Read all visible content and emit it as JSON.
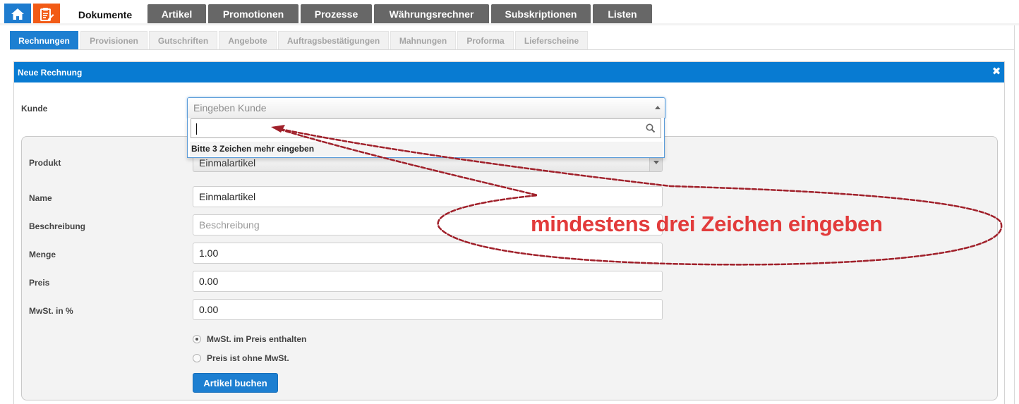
{
  "icons": {
    "home": "home-icon",
    "documents": "document-edit-icon",
    "close": "close-icon",
    "search": "search-icon"
  },
  "colors": {
    "accent": "#1d7fd1",
    "home_button": "#1e7ccf",
    "doc_button": "#f25b16",
    "tab_inactive": "#676767",
    "annotation": "#e23b3b",
    "annotation_line": "#a0202a"
  },
  "main_tabs": [
    {
      "label": "Dokumente",
      "active": true
    },
    {
      "label": "Artikel"
    },
    {
      "label": "Promotionen"
    },
    {
      "label": "Prozesse"
    },
    {
      "label": "Währungsrechner"
    },
    {
      "label": "Subskriptionen"
    },
    {
      "label": "Listen"
    }
  ],
  "sub_tabs": [
    {
      "label": "Rechnungen",
      "active": true
    },
    {
      "label": "Provisionen"
    },
    {
      "label": "Gutschriften"
    },
    {
      "label": "Angebote"
    },
    {
      "label": "Auftragsbestätigungen"
    },
    {
      "label": "Mahnungen"
    },
    {
      "label": "Proforma"
    },
    {
      "label": "Lieferscheine"
    }
  ],
  "panel": {
    "title": "Neue Rechnung",
    "close_symbol": "✖"
  },
  "form": {
    "kunde": {
      "label": "Kunde",
      "placeholder": "Eingeben Kunde",
      "search_value": "",
      "dropdown_message": "Bitte 3 Zeichen mehr eingeben"
    },
    "produkt": {
      "label": "Produkt",
      "value": "Einmalartikel"
    },
    "name": {
      "label": "Name",
      "value": "Einmalartikel"
    },
    "beschreibung": {
      "label": "Beschreibung",
      "placeholder": "Beschreibung"
    },
    "menge": {
      "label": "Menge",
      "value": "1.00"
    },
    "preis": {
      "label": "Preis",
      "value": "0.00"
    },
    "mwst": {
      "label": "MwSt. in %",
      "value": "0.00"
    },
    "radio_options": [
      {
        "label": "MwSt. im Preis enthalten",
        "checked": true
      },
      {
        "label": "Preis ist ohne MwSt.",
        "checked": false
      }
    ],
    "submit_label": "Artikel buchen"
  },
  "annotation": {
    "text": "mindestens drei Zeichen eingeben"
  }
}
